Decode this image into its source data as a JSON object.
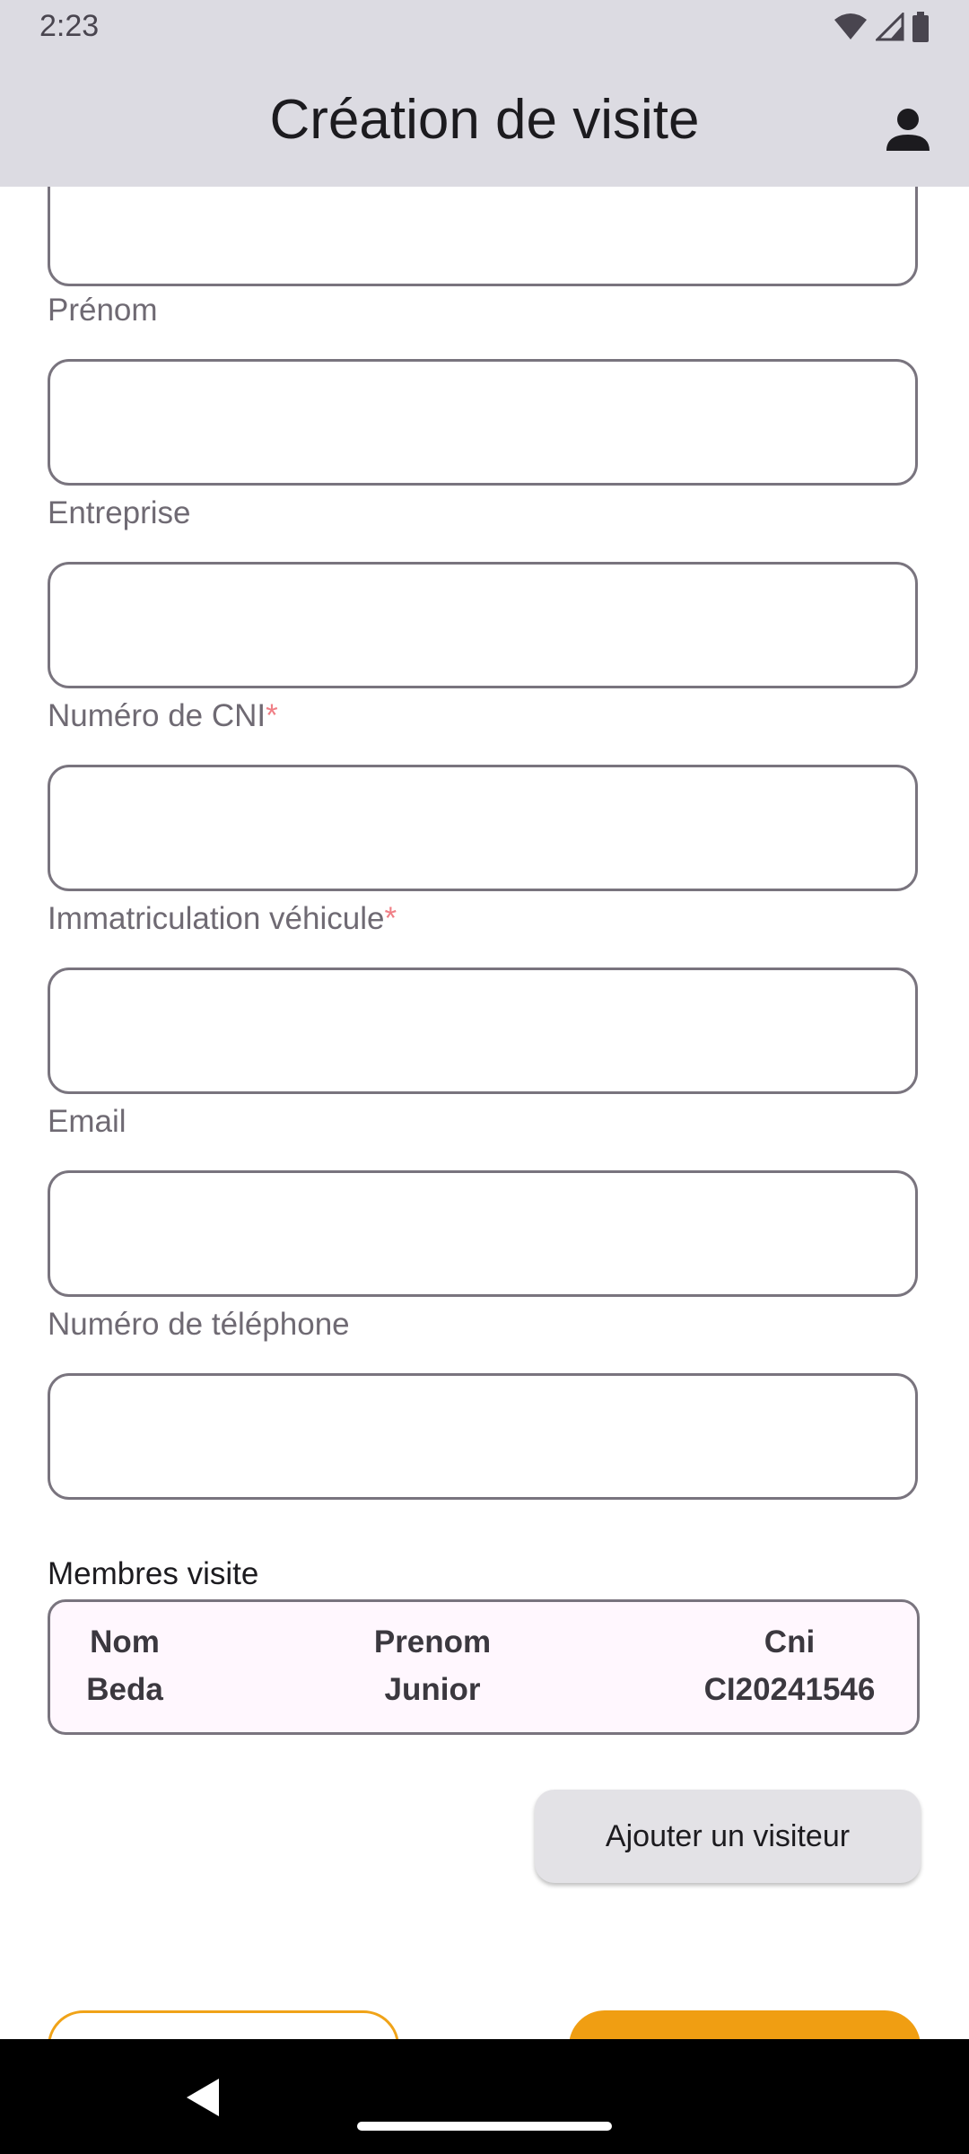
{
  "status_bar": {
    "time": "2:23"
  },
  "app_bar": {
    "title": "Création de visite"
  },
  "form": {
    "fields": [
      {
        "label": "Prénom",
        "value": "",
        "required": false
      },
      {
        "label": "Entreprise",
        "value": "",
        "required": false
      },
      {
        "label": "Numéro de CNI",
        "value": "",
        "required": true
      },
      {
        "label": "Immatriculation véhicule",
        "value": "",
        "required": true
      },
      {
        "label": "Email",
        "value": "",
        "required": false
      },
      {
        "label": "Numéro de téléphone",
        "value": "",
        "required": false
      }
    ],
    "required_marker": "*"
  },
  "members": {
    "title": "Membres visite",
    "columns": [
      "Nom",
      "Prenom",
      "Cni"
    ],
    "rows": [
      [
        "Beda",
        "Junior",
        "CI20241546"
      ]
    ]
  },
  "actions": {
    "add_visitor_label": "Ajouter un visiteur"
  },
  "colors": {
    "app_bar": "#dcdbe2",
    "accent": "#f09e12",
    "required": "#f07f86",
    "card_bg": "#fff7fe"
  }
}
